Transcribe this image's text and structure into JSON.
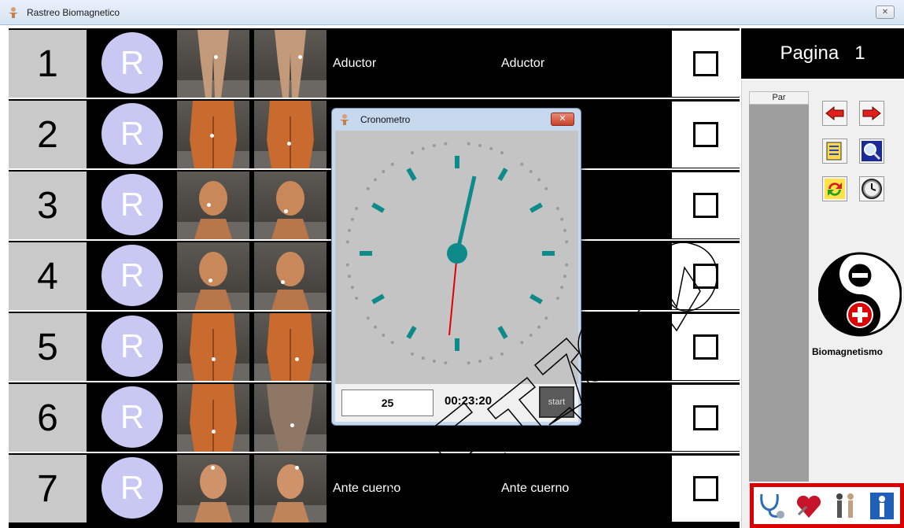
{
  "window": {
    "title": "Rastreo Biomagnetico",
    "close_label": "✕"
  },
  "rows": [
    {
      "num": "1",
      "r": "R",
      "label_left": "Aductor",
      "label_right": "Aductor"
    },
    {
      "num": "2",
      "r": "R",
      "label_left": "",
      "label_right": ""
    },
    {
      "num": "3",
      "r": "R",
      "label_left": "",
      "label_right": ""
    },
    {
      "num": "4",
      "r": "R",
      "label_left": "",
      "label_right": ""
    },
    {
      "num": "5",
      "r": "R",
      "label_left": "",
      "label_right": ""
    },
    {
      "num": "6",
      "r": "R",
      "label_left": "",
      "label_right": ""
    },
    {
      "num": "7",
      "r": "R",
      "label_left": "Ante cuerno",
      "label_right": "Ante cuerno"
    }
  ],
  "sidebar": {
    "page_label": "Pagina",
    "page_number": "1",
    "par_header": "Par",
    "brand": "Biomagnetismo",
    "tools": [
      "arrow-left-icon",
      "arrow-right-icon",
      "notes-icon",
      "zoom-icon",
      "refresh-icon",
      "clock-icon"
    ],
    "bottom_icons": [
      "stethoscope-icon",
      "heart-icon",
      "anatomy-icon",
      "body-scan-icon"
    ]
  },
  "stopwatch": {
    "title": "Cronometro",
    "count": "25",
    "time": "00:23:20",
    "start_label": "start",
    "hand_color": "#e00000",
    "marker_color": "#0f8a8a"
  },
  "colors": {
    "r_circle": "#c8c8f2",
    "alert_red": "#d80000"
  }
}
